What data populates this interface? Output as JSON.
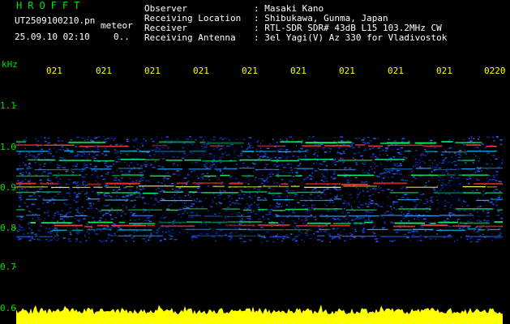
{
  "station": {
    "logo": "HROFFT",
    "filename": "UT2509100210.pn",
    "file_type": "meteor",
    "date_time": "25.09.10 02:10",
    "count": "0.."
  },
  "header": {
    "observer_label": "Observer",
    "observer_value": ": Masaki Kano",
    "location_label": "Receiving Location",
    "location_value": ": Shibukawa, Gunma, Japan",
    "receiver_label": "Receiver",
    "receiver_value": ": RTL-SDR SDR# 43dB L15 103.2MHz CW",
    "antenna_label": "Receiving Antenna",
    "antenna_value": ": 3el Yagi(V) Az 330 for Vladivostok"
  },
  "axis": {
    "unit": "kHz",
    "time_ticks": [
      "021",
      "021",
      "021",
      "021",
      "021",
      "021",
      "021",
      "021",
      "021",
      "0220"
    ],
    "freq_ticks": [
      "1.1",
      "1.0",
      "0.9",
      "0.8",
      "0.7",
      "0.6"
    ]
  },
  "colors": {
    "label_green": "#00e000",
    "tick_yellow": "#ffff00",
    "background": "#000000",
    "noise_blue": "#1030c0",
    "signal_red": "#ff3030"
  }
}
